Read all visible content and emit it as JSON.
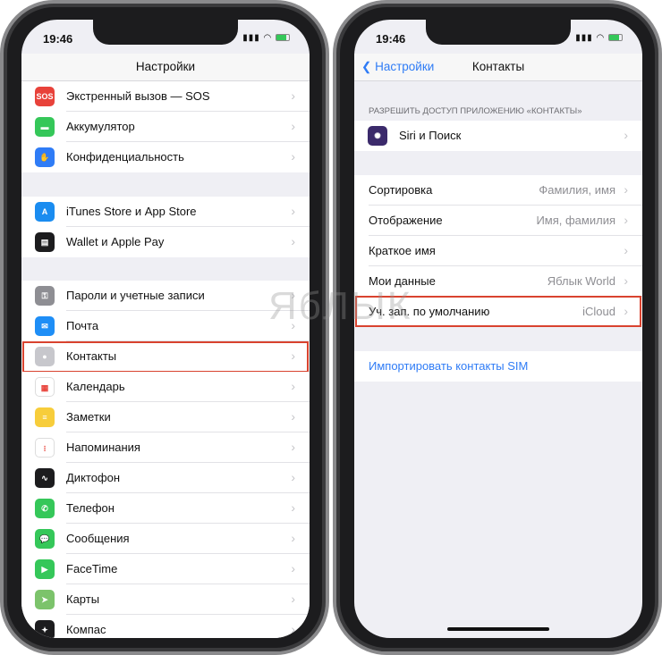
{
  "status": {
    "time": "19:46",
    "signal": "signal-icon",
    "wifi": "wifi-icon",
    "battery": "battery-charging-icon"
  },
  "left": {
    "title": "Настройки",
    "groups": [
      [
        {
          "label": "Экстренный вызов — SOS",
          "icon": "sos-icon",
          "color": "#e8423a",
          "glyph": "SOS"
        },
        {
          "label": "Аккумулятор",
          "icon": "battery-icon",
          "color": "#35c759",
          "glyph": "▬"
        },
        {
          "label": "Конфиденциальность",
          "icon": "hand-icon",
          "color": "#2f7cf6",
          "glyph": "✋"
        }
      ],
      [
        {
          "label": "iTunes Store и App Store",
          "icon": "app-store-icon",
          "color": "#1a8cf0",
          "glyph": "A"
        },
        {
          "label": "Wallet и Apple Pay",
          "icon": "wallet-icon",
          "color": "#1c1c1e",
          "glyph": "▤"
        }
      ],
      [
        {
          "label": "Пароли и учетные записи",
          "icon": "key-icon",
          "color": "#8e8e93",
          "glyph": "⚿"
        },
        {
          "label": "Почта",
          "icon": "mail-icon",
          "color": "#1e8ef6",
          "glyph": "✉"
        },
        {
          "label": "Контакты",
          "icon": "contacts-icon",
          "color": "#c7c7cc",
          "glyph": "●",
          "highlight": true
        },
        {
          "label": "Календарь",
          "icon": "calendar-icon",
          "color": "#ffffff",
          "glyph": "▦"
        },
        {
          "label": "Заметки",
          "icon": "notes-icon",
          "color": "#f7cd3b",
          "glyph": "≡"
        },
        {
          "label": "Напоминания",
          "icon": "reminders-icon",
          "color": "#ffffff",
          "glyph": "⁝"
        },
        {
          "label": "Диктофон",
          "icon": "voice-memos-icon",
          "color": "#1c1c1e",
          "glyph": "∿"
        },
        {
          "label": "Телефон",
          "icon": "phone-icon",
          "color": "#35c759",
          "glyph": "✆"
        },
        {
          "label": "Сообщения",
          "icon": "messages-icon",
          "color": "#35c759",
          "glyph": "💬"
        },
        {
          "label": "FaceTime",
          "icon": "facetime-icon",
          "color": "#35c759",
          "glyph": "▶"
        },
        {
          "label": "Карты",
          "icon": "maps-icon",
          "color": "#7cc36b",
          "glyph": "➤"
        },
        {
          "label": "Компас",
          "icon": "compass-icon",
          "color": "#1c1c1e",
          "glyph": "✦"
        }
      ]
    ]
  },
  "right": {
    "back": "Настройки",
    "title": "Контакты",
    "section_header": "РАЗРЕШИТЬ ДОСТУП ПРИЛОЖЕНИЮ «КОНТАКТЫ»",
    "siri": {
      "label": "Siri и Поиск",
      "icon": "siri-icon"
    },
    "rows": [
      {
        "label": "Сортировка",
        "value": "Фамилия, имя"
      },
      {
        "label": "Отображение",
        "value": "Имя, фамилия"
      },
      {
        "label": "Краткое имя",
        "value": ""
      },
      {
        "label": "Мои данные",
        "value": "Яблык World"
      },
      {
        "label": "Уч. зап. по умолчанию",
        "value": "iCloud",
        "highlight": true
      }
    ],
    "import": "Импортировать контакты SIM"
  },
  "watermark": "ЯБЛЫК",
  "colors": {
    "highlight": "#d9432f",
    "accent": "#2f7cf6"
  }
}
